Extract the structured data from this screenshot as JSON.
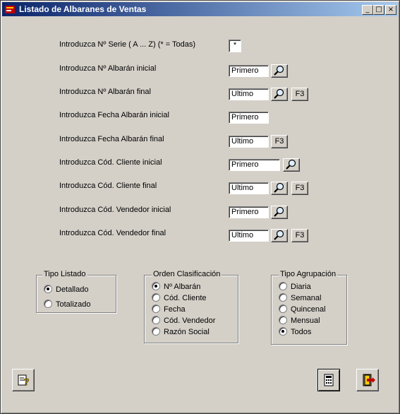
{
  "window": {
    "title": "Listado de Albaranes de Ventas",
    "controls": {
      "minimize": "_",
      "maximize": "□",
      "close": "×"
    }
  },
  "fields": [
    {
      "label": "Introduzca Nº Serie ( A ... Z) (* = Todas)",
      "value": "*",
      "search": false,
      "f3": false
    },
    {
      "label": "Introduzca Nº Albarán inicial",
      "value": "Primero",
      "search": true,
      "f3": false
    },
    {
      "label": "Introduzca Nº Albarán final",
      "value": "Ultimo",
      "search": true,
      "f3": true
    },
    {
      "label": "Introduzca Fecha Albarán inicial",
      "value": "Primero",
      "search": false,
      "f3": false
    },
    {
      "label": "Introduzca Fecha Albarán final",
      "value": "Ultimo",
      "search": false,
      "f3": true
    },
    {
      "label": "Introduzca Cód. Cliente inicial",
      "value": "Primero",
      "search": true,
      "f3": false
    },
    {
      "label": "Introduzca Cód. Cliente final",
      "value": "Ultimo",
      "search": true,
      "f3": true
    },
    {
      "label": "Introduzca Cód. Vendedor inicial",
      "value": "Primero",
      "search": true,
      "f3": false
    },
    {
      "label": "Introduzca Cód. Vendedor final",
      "value": "Ultimo",
      "search": true,
      "f3": true
    }
  ],
  "f3_label": "F3",
  "groups": {
    "tipo_listado": {
      "title": "Tipo Listado",
      "options": [
        "Detallado",
        "Totalizado"
      ],
      "selected": 0
    },
    "orden": {
      "title": "Orden Clasificación",
      "options": [
        "Nº Albarán",
        "Cód. Cliente",
        "Fecha",
        "Cód. Vendedor",
        "Razón Social"
      ],
      "selected": 0
    },
    "agrupacion": {
      "title": "Tipo Agrupación",
      "options": [
        "Diaria",
        "Semanal",
        "Quincenal",
        "Mensual",
        "Todos"
      ],
      "selected": 4
    }
  },
  "buttons": {
    "help": "help-icon",
    "print": "print-icon",
    "exit": "exit-icon"
  }
}
